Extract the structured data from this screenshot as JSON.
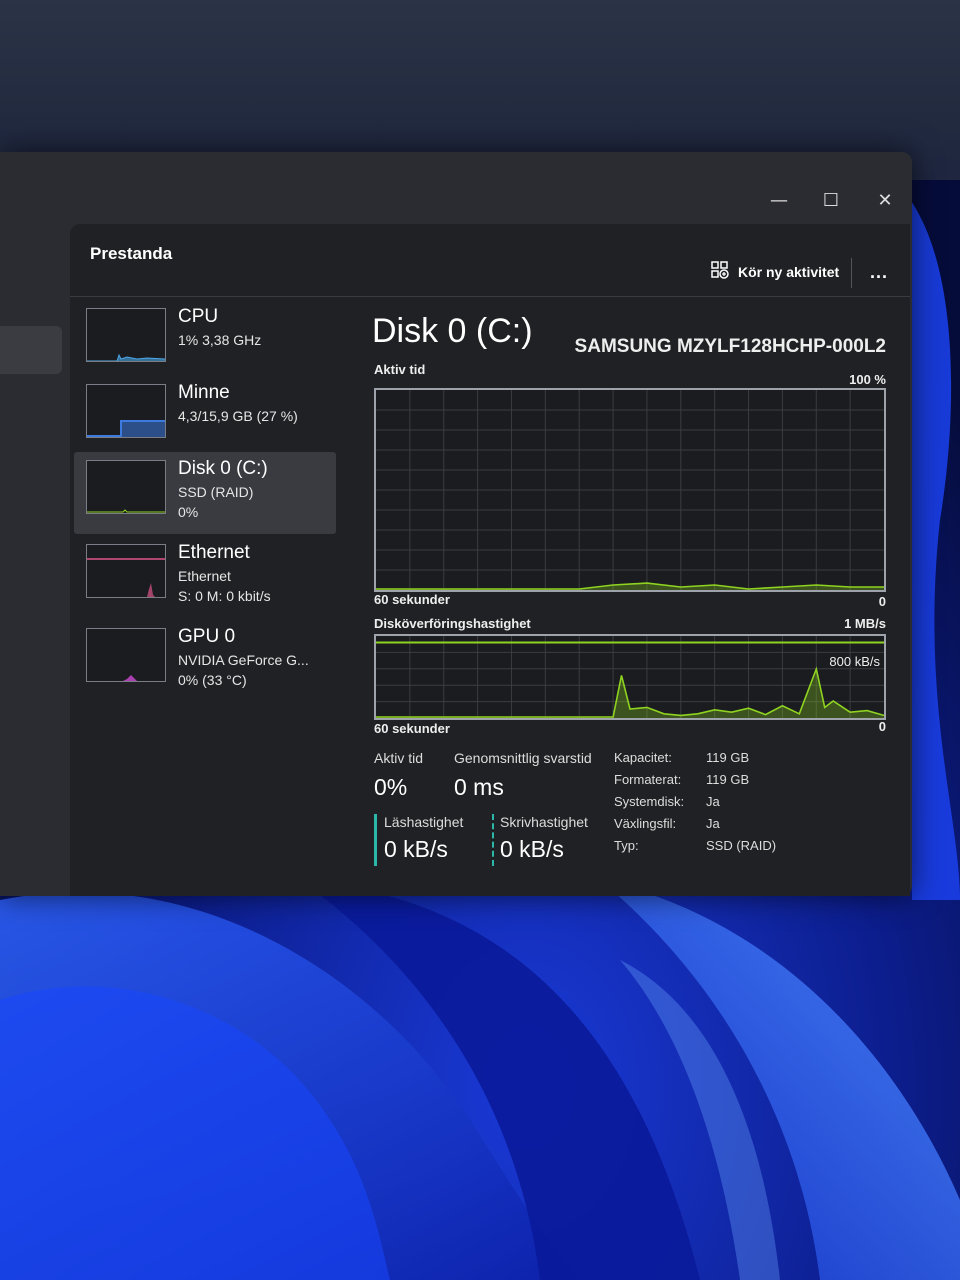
{
  "window": {
    "title": "Prestanda",
    "run_task_label": "Kör ny aktivitet",
    "more_label": "..."
  },
  "window_controls": {
    "minimize": "—",
    "maximize": "☐",
    "close": "✕"
  },
  "devices": [
    {
      "name": "CPU",
      "line1": "1% 3,38 GHz",
      "line2": ""
    },
    {
      "name": "Minne",
      "line1": "4,3/15,9 GB (27 %)",
      "line2": ""
    },
    {
      "name": "Disk 0 (C:)",
      "line1": "SSD (RAID)",
      "line2": "0%"
    },
    {
      "name": "Ethernet",
      "line1": "Ethernet",
      "line2": "S: 0 M: 0 kbit/s"
    },
    {
      "name": "GPU 0",
      "line1": "NVIDIA GeForce G...",
      "line2": "0% (33 °C)"
    }
  ],
  "disk": {
    "title": "Disk 0 (C:)",
    "model": "SAMSUNG MZYLF128HCHP-000L2",
    "chart_active": {
      "label": "Aktiv tid",
      "max_label": "100 %",
      "time_label": "60 sekunder",
      "min_label": "0"
    },
    "chart_transfer": {
      "label": "Disköverföringshastighet",
      "max_label": "1 MB/s",
      "mid_label": "800 kB/s",
      "time_label": "60 sekunder",
      "min_label": "0"
    }
  },
  "stats": {
    "active_time_label": "Aktiv tid",
    "active_time_value": "0%",
    "avg_response_label": "Genomsnittlig svarstid",
    "avg_response_value": "0 ms",
    "read_label": "Läshastighet",
    "read_value": "0 kB/s",
    "write_label": "Skrivhastighet",
    "write_value": "0 kB/s"
  },
  "properties": [
    {
      "label": "Kapacitet:",
      "value": "119 GB"
    },
    {
      "label": "Formaterat:",
      "value": "119 GB"
    },
    {
      "label": "Systemdisk:",
      "value": "Ja"
    },
    {
      "label": "Växlingsfil:",
      "value": "Ja"
    },
    {
      "label": "Typ:",
      "value": "SSD (RAID)"
    }
  ],
  "colors": {
    "accent_green": "#8fd321",
    "cpu_blue": "#4aa7e8",
    "memory_blue": "#3d7ae0",
    "ethernet_pink": "#e0558a",
    "gpu_magenta": "#d04bd6",
    "teal": "#2bb8a8"
  },
  "chart_data": [
    {
      "type": "area",
      "title": "Aktiv tid",
      "xlabel": "60 sekunder",
      "ylim": [
        0,
        100
      ],
      "x": [
        0,
        4,
        8,
        12,
        16,
        20,
        24,
        28,
        32,
        36,
        40,
        44,
        48,
        52,
        56,
        60
      ],
      "series": [
        {
          "values": [
            0,
            0,
            0,
            0,
            0,
            0,
            0,
            2,
            3,
            1,
            2,
            0,
            1,
            2,
            1,
            1
          ]
        }
      ]
    },
    {
      "type": "area",
      "title": "Disköverföringshastighet",
      "xlabel": "60 sekunder",
      "ylim": [
        0,
        1000
      ],
      "x": [
        0,
        4,
        8,
        12,
        16,
        20,
        24,
        28,
        29,
        30,
        32,
        34,
        36,
        38,
        40,
        42,
        44,
        46,
        48,
        50,
        52,
        53,
        54,
        56,
        58,
        60
      ],
      "series": [
        {
          "values": [
            0,
            0,
            0,
            0,
            0,
            0,
            0,
            0,
            520,
            100,
            120,
            40,
            20,
            40,
            90,
            60,
            110,
            30,
            140,
            40,
            600,
            120,
            200,
            60,
            80,
            20
          ]
        }
      ]
    }
  ]
}
